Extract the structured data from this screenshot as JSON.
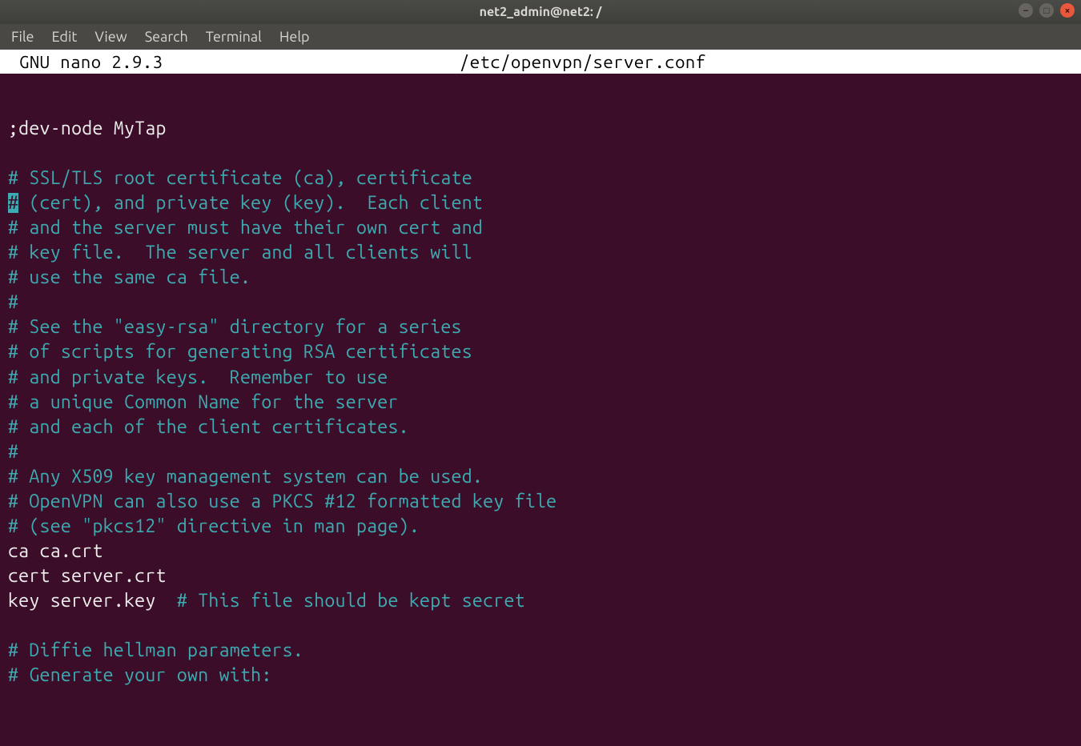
{
  "window": {
    "title": "net2_admin@net2: /"
  },
  "menubar": {
    "file": "File",
    "edit": "Edit",
    "view": "View",
    "search": "Search",
    "terminal": "Terminal",
    "help": "Help"
  },
  "nano": {
    "version_label": "  GNU nano 2.9.3",
    "filepath": "/etc/openvpn/server.conf"
  },
  "editor_lines": [
    {
      "class": "plain",
      "text": ""
    },
    {
      "class": "plain",
      "text": ";dev-node MyTap"
    },
    {
      "class": "plain",
      "text": ""
    },
    {
      "class": "comment",
      "text": "# SSL/TLS root certificate (ca), certificate"
    },
    {
      "class": "comment",
      "cursor_first": "#",
      "rest": " (cert), and private key (key).  Each client"
    },
    {
      "class": "comment",
      "text": "# and the server must have their own cert and"
    },
    {
      "class": "comment",
      "text": "# key file.  The server and all clients will"
    },
    {
      "class": "comment",
      "text": "# use the same ca file."
    },
    {
      "class": "comment",
      "text": "#"
    },
    {
      "class": "comment",
      "text": "# See the \"easy-rsa\" directory for a series"
    },
    {
      "class": "comment",
      "text": "# of scripts for generating RSA certificates"
    },
    {
      "class": "comment",
      "text": "# and private keys.  Remember to use"
    },
    {
      "class": "comment",
      "text": "# a unique Common Name for the server"
    },
    {
      "class": "comment",
      "text": "# and each of the client certificates."
    },
    {
      "class": "comment",
      "text": "#"
    },
    {
      "class": "comment",
      "text": "# Any X509 key management system can be used."
    },
    {
      "class": "comment",
      "text": "# OpenVPN can also use a PKCS #12 formatted key file"
    },
    {
      "class": "comment",
      "text": "# (see \"pkcs12\" directive in man page)."
    },
    {
      "class": "plain",
      "text": "ca ca.crt"
    },
    {
      "class": "plain",
      "text": "cert server.crt"
    },
    {
      "class": "mixed",
      "plain_part": "key server.key  ",
      "comment_part": "# This file should be kept secret"
    },
    {
      "class": "plain",
      "text": ""
    },
    {
      "class": "comment",
      "text": "# Diffie hellman parameters."
    },
    {
      "class": "comment",
      "text": "# Generate your own with:"
    }
  ]
}
